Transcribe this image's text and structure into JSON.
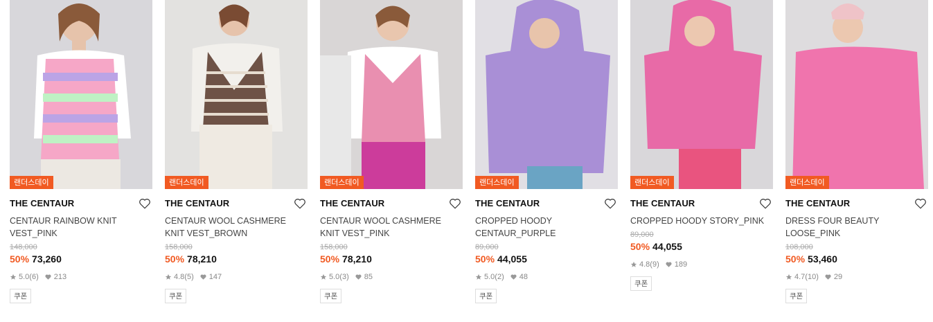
{
  "products": [
    {
      "badge": "랜더스데이",
      "brand": "THE CENTAUR",
      "name": "CENTAUR RAINBOW KNIT VEST_PINK",
      "original_price": "148,000",
      "discount": "50%",
      "price": "73,260",
      "rating": "5.0",
      "review_count": "(6)",
      "likes": "213",
      "coupon": "쿠폰",
      "bg": "#d8d7db",
      "garment": "#f6a7c7"
    },
    {
      "badge": "랜더스데이",
      "brand": "THE CENTAUR",
      "name": "CENTAUR WOOL CASHMERE KNIT VEST_BROWN",
      "original_price": "158,000",
      "discount": "50%",
      "price": "78,210",
      "rating": "4.8",
      "review_count": "(5)",
      "likes": "147",
      "coupon": "쿠폰",
      "bg": "#e3e2e0",
      "garment": "#6e5246"
    },
    {
      "badge": "랜더스데이",
      "brand": "THE CENTAUR",
      "name": "CENTAUR WOOL CASHMERE KNIT VEST_PINK",
      "original_price": "158,000",
      "discount": "50%",
      "price": "78,210",
      "rating": "5.0",
      "review_count": "(3)",
      "likes": "85",
      "coupon": "쿠폰",
      "bg": "#d9d6d6",
      "garment": "#e98fb0"
    },
    {
      "badge": "랜더스데이",
      "brand": "THE CENTAUR",
      "name": "CROPPED HOODY CENTAUR_PURPLE",
      "original_price": "89,000",
      "discount": "50%",
      "price": "44,055",
      "rating": "5.0",
      "review_count": "(2)",
      "likes": "48",
      "coupon": "쿠폰",
      "bg": "#e1dfe4",
      "garment": "#a98fd6"
    },
    {
      "badge": "랜더스데이",
      "brand": "THE CENTAUR",
      "name": "CROPPED HOODY STORY_PINK",
      "original_price": "89,000",
      "discount": "50%",
      "price": "44,055",
      "rating": "4.8",
      "review_count": "(9)",
      "likes": "189",
      "coupon": "쿠폰",
      "bg": "#d9d7da",
      "garment": "#e86aa7"
    },
    {
      "badge": "랜더스데이",
      "brand": "THE CENTAUR",
      "name": "DRESS FOUR BEAUTY LOOSE_PINK",
      "original_price": "108,000",
      "discount": "50%",
      "price": "53,460",
      "rating": "4.7",
      "review_count": "(10)",
      "likes": "29",
      "coupon": "쿠폰",
      "bg": "#dedcde",
      "garment": "#f074ad"
    }
  ]
}
